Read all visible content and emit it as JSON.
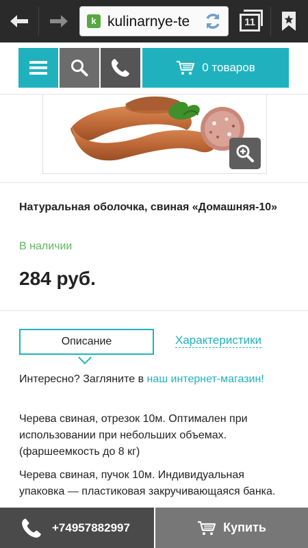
{
  "browser": {
    "url_text": "kulinarnye-te",
    "favicon_letter": "k",
    "tab_count": "11"
  },
  "header": {
    "cart_label": "0 товаров"
  },
  "product": {
    "title": "Натуральная оболочка, свиная «Домашняя-10»",
    "stock_status": "В наличии",
    "price": "284 руб."
  },
  "tabs": {
    "description": "Описание",
    "characteristics": "Характеристики"
  },
  "description": {
    "intro_text": "Интересно? Загляните в ",
    "intro_link": "наш интернет-магазин!",
    "paragraph_1": "Черева свиная, отрезок 10м. Оптимален при использовании при небольших объемах. (фаршеемкость до 8 кг)",
    "paragraph_2": "Черева свиная, пучок 10м. Индивидуальная упаковка — пластиковая закручивающаяся банка."
  },
  "bottom_bar": {
    "phone": "+74957882997",
    "buy_label": "Купить"
  },
  "colors": {
    "accent": "#1fb2be",
    "stock_green": "#5cb85c",
    "dark_gray": "#4a4a4a"
  }
}
